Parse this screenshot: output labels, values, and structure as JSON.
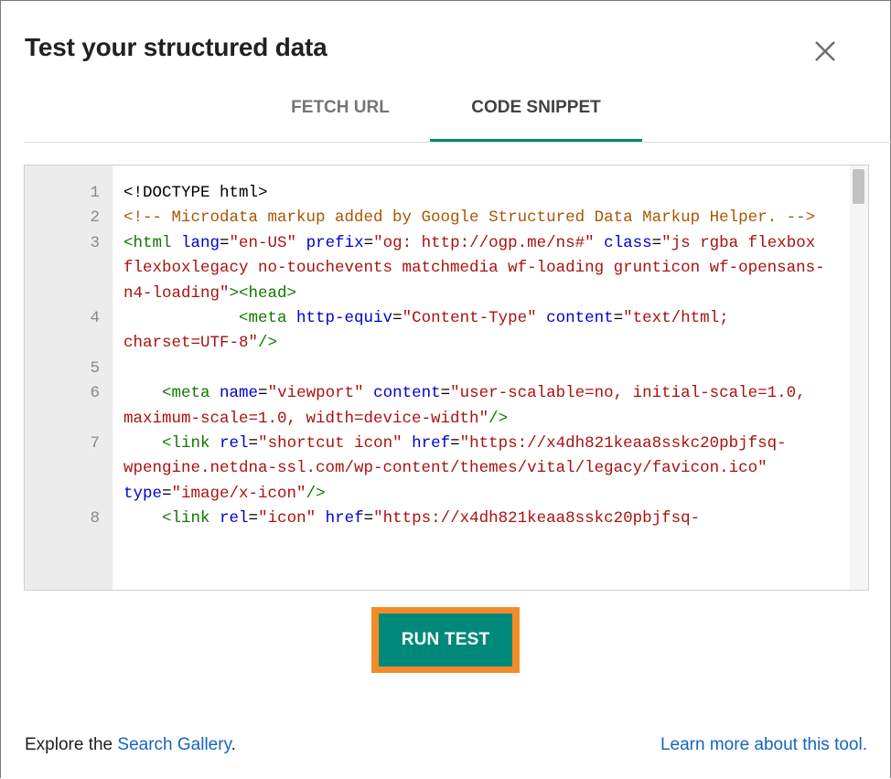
{
  "dialog": {
    "title": "Test your structured data",
    "close_icon": "close-icon"
  },
  "tabs": [
    {
      "label": "FETCH URL",
      "active": false
    },
    {
      "label": "CODE SNIPPET",
      "active": true
    }
  ],
  "editor": {
    "lines": [
      {
        "num": "1",
        "segments": [
          {
            "t": "<!DOCTYPE html>",
            "c": "plain"
          }
        ]
      },
      {
        "num": "2",
        "segments": [
          {
            "t": "<!-- Microdata markup added by Google Structured Data Markup Helper. -->",
            "c": "com"
          }
        ]
      },
      {
        "num": "3",
        "segments": [
          {
            "t": "<html ",
            "c": "tag"
          },
          {
            "t": "lang",
            "c": "attr"
          },
          {
            "t": "=",
            "c": "plain"
          },
          {
            "t": "\"en-US\"",
            "c": "str"
          },
          {
            "t": " prefix",
            "c": "attr"
          },
          {
            "t": "=",
            "c": "plain"
          },
          {
            "t": "\"og: http://ogp.me/ns#\"",
            "c": "str"
          },
          {
            "t": " class",
            "c": "attr"
          },
          {
            "t": "=",
            "c": "plain"
          },
          {
            "t": "\"js rgba flexbox flexboxlegacy no-touchevents matchmedia wf-loading grunticon wf-opensans-n4-loading\"",
            "c": "str"
          },
          {
            "t": "><head>",
            "c": "tag"
          }
        ]
      },
      {
        "num": "4",
        "segments": [
          {
            "t": "            <meta ",
            "c": "tag"
          },
          {
            "t": "http-equiv",
            "c": "attr"
          },
          {
            "t": "=",
            "c": "plain"
          },
          {
            "t": "\"Content-Type\"",
            "c": "str"
          },
          {
            "t": " content",
            "c": "attr"
          },
          {
            "t": "=",
            "c": "plain"
          },
          {
            "t": "\"text/html; charset=UTF-8\"",
            "c": "str"
          },
          {
            "t": "/>",
            "c": "tag"
          }
        ]
      },
      {
        "num": "5",
        "segments": [
          {
            "t": " ",
            "c": "plain"
          }
        ]
      },
      {
        "num": "6",
        "segments": [
          {
            "t": "    <meta ",
            "c": "tag"
          },
          {
            "t": "name",
            "c": "attr"
          },
          {
            "t": "=",
            "c": "plain"
          },
          {
            "t": "\"viewport\"",
            "c": "str"
          },
          {
            "t": " content",
            "c": "attr"
          },
          {
            "t": "=",
            "c": "plain"
          },
          {
            "t": "\"user-scalable=no, initial-scale=1.0, maximum-scale=1.0, width=device-width\"",
            "c": "str"
          },
          {
            "t": "/>",
            "c": "tag"
          }
        ]
      },
      {
        "num": "7",
        "segments": [
          {
            "t": "    <link ",
            "c": "tag"
          },
          {
            "t": "rel",
            "c": "attr"
          },
          {
            "t": "=",
            "c": "plain"
          },
          {
            "t": "\"shortcut icon\"",
            "c": "str"
          },
          {
            "t": " href",
            "c": "attr"
          },
          {
            "t": "=",
            "c": "plain"
          },
          {
            "t": "\"https://x4dh821keaa8sskc20pbjfsq-wpengine.netdna-ssl.com/wp-content/themes/vital/legacy/favicon.ico\"",
            "c": "str"
          },
          {
            "t": " type",
            "c": "attr"
          },
          {
            "t": "=",
            "c": "plain"
          },
          {
            "t": "\"image/x-icon\"",
            "c": "str"
          },
          {
            "t": "/>",
            "c": "tag"
          }
        ]
      },
      {
        "num": "8",
        "segments": [
          {
            "t": "    <link ",
            "c": "tag"
          },
          {
            "t": "rel",
            "c": "attr"
          },
          {
            "t": "=",
            "c": "plain"
          },
          {
            "t": "\"icon\"",
            "c": "str"
          },
          {
            "t": " href",
            "c": "attr"
          },
          {
            "t": "=",
            "c": "plain"
          },
          {
            "t": "\"https://x4dh821keaa8sskc20pbjfsq-",
            "c": "str"
          }
        ]
      }
    ]
  },
  "run_button": {
    "label": "RUN TEST"
  },
  "footer": {
    "explore_prefix": "Explore the ",
    "gallery_link": "Search Gallery",
    "explore_suffix": ".",
    "learn_link": "Learn more about this tool."
  },
  "colors": {
    "accent": "#00897b",
    "highlight": "#f28c28",
    "link": "#1565c0"
  }
}
